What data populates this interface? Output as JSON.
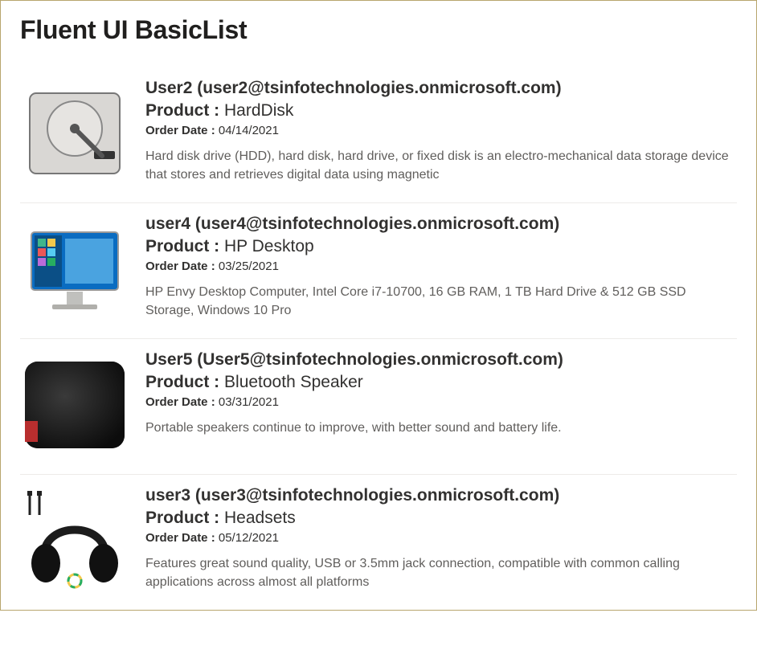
{
  "title": "Fluent UI BasicList",
  "labels": {
    "product": "Product :",
    "orderDate": "Order Date :"
  },
  "items": [
    {
      "imageAlt": "hard-disk-image",
      "user": "User2 (user2@tsinfotechnologies.onmicrosoft.com)",
      "product": "HardDisk",
      "orderDate": "04/14/2021",
      "description": "Hard disk drive (HDD), hard disk, hard drive, or fixed disk is an electro-mechanical data storage device that stores and retrieves digital data using magnetic"
    },
    {
      "imageAlt": "hp-desktop-image",
      "user": "user4 (user4@tsinfotechnologies.onmicrosoft.com)",
      "product": "HP Desktop",
      "orderDate": "03/25/2021",
      "description": "HP Envy Desktop Computer, Intel Core i7-10700, 16 GB RAM, 1 TB Hard Drive & 512 GB SSD Storage, Windows 10 Pro"
    },
    {
      "imageAlt": "bluetooth-speaker-image",
      "user": "User5 (User5@tsinfotechnologies.onmicrosoft.com)",
      "product": "Bluetooth Speaker",
      "orderDate": "03/31/2021",
      "description": "Portable speakers continue to improve, with better sound and battery life."
    },
    {
      "imageAlt": "headsets-image",
      "user": "user3 (user3@tsinfotechnologies.onmicrosoft.com)",
      "product": "Headsets",
      "orderDate": "05/12/2021",
      "description": "Features great sound quality, USB or 3.5mm jack connection, compatible with common calling applications across almost all platforms"
    }
  ]
}
